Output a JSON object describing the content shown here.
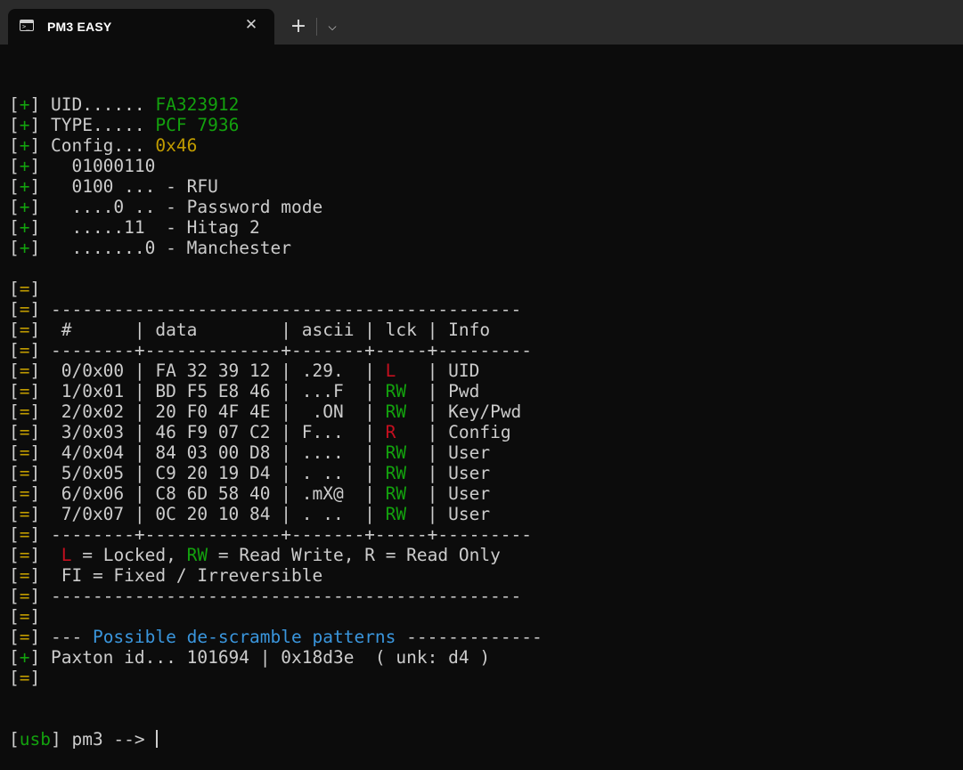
{
  "window": {
    "tab_title": "PM3 EASY",
    "close_glyph": "✕",
    "new_tab_glyph": "+",
    "dropdown_glyph": "⌵"
  },
  "terminal": {
    "lines": [
      {
        "segs": [
          {
            "t": "["
          },
          {
            "t": "+",
            "c": "g"
          },
          {
            "t": "] UID...... "
          },
          {
            "t": "FA323912",
            "c": "g"
          }
        ]
      },
      {
        "segs": [
          {
            "t": "["
          },
          {
            "t": "+",
            "c": "g"
          },
          {
            "t": "] TYPE..... "
          },
          {
            "t": "PCF 7936",
            "c": "g"
          }
        ]
      },
      {
        "segs": [
          {
            "t": "["
          },
          {
            "t": "+",
            "c": "g"
          },
          {
            "t": "] Config... "
          },
          {
            "t": "0x46",
            "c": "y"
          }
        ]
      },
      {
        "segs": [
          {
            "t": "["
          },
          {
            "t": "+",
            "c": "g"
          },
          {
            "t": "]   01000110"
          }
        ]
      },
      {
        "segs": [
          {
            "t": "["
          },
          {
            "t": "+",
            "c": "g"
          },
          {
            "t": "]   0100 ... - RFU"
          }
        ]
      },
      {
        "segs": [
          {
            "t": "["
          },
          {
            "t": "+",
            "c": "g"
          },
          {
            "t": "]   ....0 .. - Password mode"
          }
        ]
      },
      {
        "segs": [
          {
            "t": "["
          },
          {
            "t": "+",
            "c": "g"
          },
          {
            "t": "]   .....11  - Hitag 2"
          }
        ]
      },
      {
        "segs": [
          {
            "t": "["
          },
          {
            "t": "+",
            "c": "g"
          },
          {
            "t": "]   .......0 - Manchester"
          }
        ]
      },
      {
        "segs": [
          {
            "t": ""
          }
        ]
      },
      {
        "segs": [
          {
            "t": "["
          },
          {
            "t": "=",
            "c": "y"
          },
          {
            "t": "]"
          }
        ]
      },
      {
        "segs": [
          {
            "t": "["
          },
          {
            "t": "=",
            "c": "y"
          },
          {
            "t": "] ---------------------------------------------"
          }
        ]
      },
      {
        "segs": [
          {
            "t": "["
          },
          {
            "t": "=",
            "c": "y"
          },
          {
            "t": "]  #      | data        | ascii | lck | Info"
          }
        ]
      },
      {
        "segs": [
          {
            "t": "["
          },
          {
            "t": "=",
            "c": "y"
          },
          {
            "t": "] --------+-------------+-------+-----+---------"
          }
        ]
      },
      {
        "segs": [
          {
            "t": "["
          },
          {
            "t": "=",
            "c": "y"
          },
          {
            "t": "]  0/0x00 | FA 32 39 12 | .29.  | "
          },
          {
            "t": "L ",
            "c": "r"
          },
          {
            "t": "  | UID"
          }
        ]
      },
      {
        "segs": [
          {
            "t": "["
          },
          {
            "t": "=",
            "c": "y"
          },
          {
            "t": "]  1/0x01 | BD F5 E8 46 | ...F  | "
          },
          {
            "t": "RW",
            "c": "g"
          },
          {
            "t": "  | Pwd"
          }
        ]
      },
      {
        "segs": [
          {
            "t": "["
          },
          {
            "t": "=",
            "c": "y"
          },
          {
            "t": "]  2/0x02 | 20 F0 4F 4E |  .ON  | "
          },
          {
            "t": "RW",
            "c": "g"
          },
          {
            "t": "  | Key/Pwd"
          }
        ]
      },
      {
        "segs": [
          {
            "t": "["
          },
          {
            "t": "=",
            "c": "y"
          },
          {
            "t": "]  3/0x03 | 46 F9 07 C2 | F...  | "
          },
          {
            "t": "R ",
            "c": "r"
          },
          {
            "t": "  | Config"
          }
        ]
      },
      {
        "segs": [
          {
            "t": "["
          },
          {
            "t": "=",
            "c": "y"
          },
          {
            "t": "]  4/0x04 | 84 03 00 D8 | ....  | "
          },
          {
            "t": "RW",
            "c": "g"
          },
          {
            "t": "  | User"
          }
        ]
      },
      {
        "segs": [
          {
            "t": "["
          },
          {
            "t": "=",
            "c": "y"
          },
          {
            "t": "]  5/0x05 | C9 20 19 D4 | . ..  | "
          },
          {
            "t": "RW",
            "c": "g"
          },
          {
            "t": "  | User"
          }
        ]
      },
      {
        "segs": [
          {
            "t": "["
          },
          {
            "t": "=",
            "c": "y"
          },
          {
            "t": "]  6/0x06 | C8 6D 58 40 | .mX@  | "
          },
          {
            "t": "RW",
            "c": "g"
          },
          {
            "t": "  | User"
          }
        ]
      },
      {
        "segs": [
          {
            "t": "["
          },
          {
            "t": "=",
            "c": "y"
          },
          {
            "t": "]  7/0x07 | 0C 20 10 84 | . ..  | "
          },
          {
            "t": "RW",
            "c": "g"
          },
          {
            "t": "  | User"
          }
        ]
      },
      {
        "segs": [
          {
            "t": "["
          },
          {
            "t": "=",
            "c": "y"
          },
          {
            "t": "] --------+-------------+-------+-----+---------"
          }
        ]
      },
      {
        "segs": [
          {
            "t": "["
          },
          {
            "t": "=",
            "c": "y"
          },
          {
            "t": "]  "
          },
          {
            "t": "L",
            "c": "r"
          },
          {
            "t": " = Locked, "
          },
          {
            "t": "RW",
            "c": "g"
          },
          {
            "t": " = Read Write, R = Read Only"
          }
        ]
      },
      {
        "segs": [
          {
            "t": "["
          },
          {
            "t": "=",
            "c": "y"
          },
          {
            "t": "]  FI = Fixed / Irreversible"
          }
        ]
      },
      {
        "segs": [
          {
            "t": "["
          },
          {
            "t": "=",
            "c": "y"
          },
          {
            "t": "] ---------------------------------------------"
          }
        ]
      },
      {
        "segs": [
          {
            "t": "["
          },
          {
            "t": "=",
            "c": "y"
          },
          {
            "t": "]"
          }
        ]
      },
      {
        "segs": [
          {
            "t": "["
          },
          {
            "t": "=",
            "c": "y"
          },
          {
            "t": "] --- "
          },
          {
            "t": "Possible de-scramble patterns",
            "c": "b"
          },
          {
            "t": " -------------"
          }
        ]
      },
      {
        "segs": [
          {
            "t": "["
          },
          {
            "t": "+",
            "c": "g"
          },
          {
            "t": "] Paxton id... 101694 | 0x18d3e  ( unk: d4 )"
          }
        ]
      },
      {
        "segs": [
          {
            "t": "["
          },
          {
            "t": "=",
            "c": "y"
          },
          {
            "t": "]"
          }
        ]
      }
    ],
    "prompt": {
      "bracket_open": "[",
      "device": "usb",
      "bracket_close": "]",
      "text": " pm3 --> "
    }
  }
}
